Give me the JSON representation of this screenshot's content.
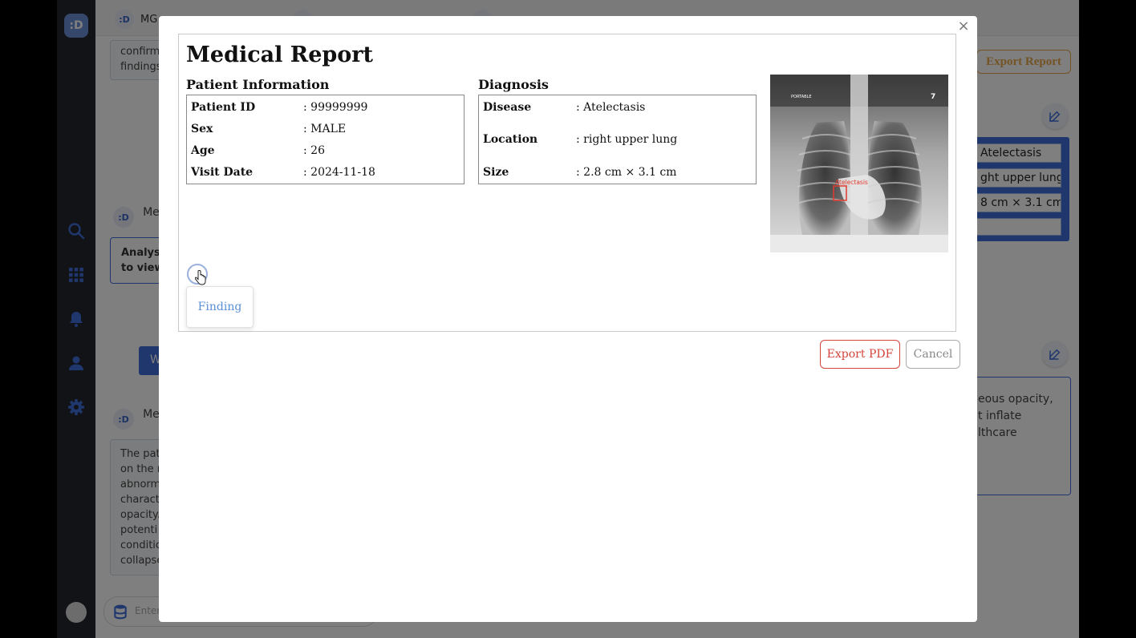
{
  "app": {
    "logo_text": ":D",
    "tabs": [
      {
        "logo": ":D",
        "label": "MG"
      },
      {
        "logo": ":D",
        "label": ""
      },
      {
        "logo": ":D",
        "label": ""
      }
    ],
    "background": {
      "top_text": "confirm\nfindings",
      "message_sender": "Me",
      "analysis_text": "Analysi\nto view",
      "button_partial": "W",
      "paragraph": "The pati\non the r\nabnorm\ncharact\nopacity.\npotenti\nconditic\ncollapse",
      "export_report_label": "Export Report",
      "right_cells": [
        "Atelectasis",
        "ght upper lung",
        "8 cm × 3.1 cm",
        ""
      ],
      "right_text": "eous opacity,\nt inflate\nlthcare",
      "chat_placeholder": "Enter"
    }
  },
  "modal": {
    "close_label": "×",
    "title": "Medical Report",
    "patient_info": {
      "heading": "Patient Information",
      "rows": [
        {
          "label": "Patient ID",
          "value": ": 99999999"
        },
        {
          "label": "Sex",
          "value": ": MALE"
        },
        {
          "label": "Age",
          "value": ": 26"
        },
        {
          "label": "Visit Date",
          "value": ": 2024-11-18"
        }
      ]
    },
    "diagnosis": {
      "heading": "Diagnosis",
      "rows": [
        {
          "label": "Disease",
          "value": ": Atelectasis"
        },
        {
          "label": "Location",
          "value": ": right upper lung"
        },
        {
          "label": "Size",
          "value": ": 2.8 cm × 3.1 cm"
        }
      ]
    },
    "xray": {
      "marker_left": "PORTABLE",
      "marker_right": "7",
      "annotation_label": "Atelectasis",
      "annotation_color": "#e23b2e"
    },
    "finding_label": "Finding",
    "buttons": {
      "export_pdf": "Export PDF",
      "cancel": "Cancel"
    }
  }
}
